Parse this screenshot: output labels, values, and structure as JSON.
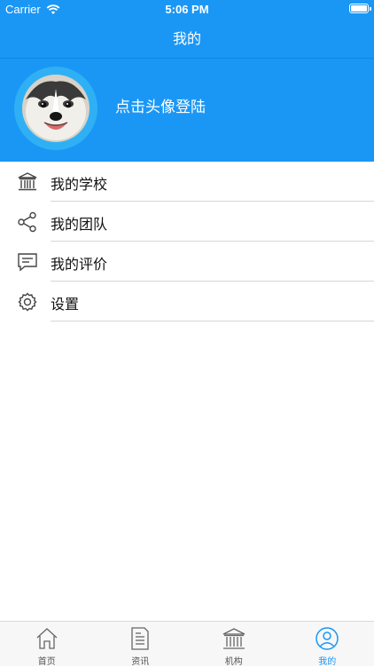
{
  "status_bar": {
    "carrier": "Carrier",
    "time": "5:06 PM"
  },
  "nav": {
    "title": "我的"
  },
  "profile": {
    "login_text": "点击头像登陆"
  },
  "menu": {
    "items": [
      {
        "label": "我的学校",
        "icon": "bank-icon"
      },
      {
        "label": "我的团队",
        "icon": "share-icon"
      },
      {
        "label": "我的评价",
        "icon": "comment-icon"
      },
      {
        "label": "设置",
        "icon": "gear-icon"
      }
    ]
  },
  "tabs": [
    {
      "label": "首页",
      "icon": "home-icon",
      "active": false
    },
    {
      "label": "资讯",
      "icon": "document-icon",
      "active": false
    },
    {
      "label": "机构",
      "icon": "bank-icon",
      "active": false
    },
    {
      "label": "我的",
      "icon": "user-icon",
      "active": true
    }
  ],
  "colors": {
    "primary": "#1a97f5",
    "avatar_ring": "#2fb0f4",
    "tab_active": "#1a97f5",
    "tab_inactive": "#555555"
  }
}
